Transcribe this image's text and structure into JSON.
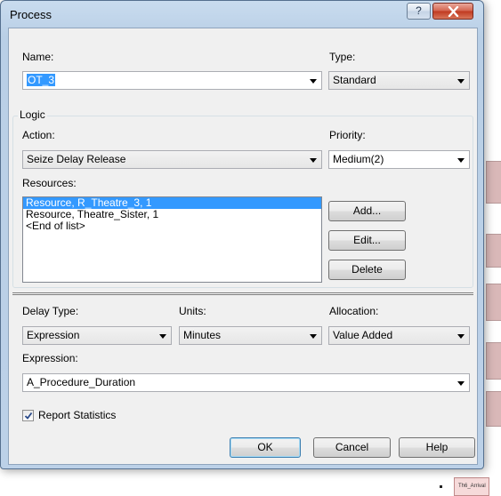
{
  "window": {
    "title": "Process",
    "help_glyph": "?",
    "close_glyph": "x"
  },
  "name": {
    "label": "Name:",
    "value": "OT_3"
  },
  "type": {
    "label": "Type:",
    "value": "Standard"
  },
  "logic": {
    "legend": "Logic",
    "action": {
      "label": "Action:",
      "value": "Seize Delay Release"
    },
    "priority": {
      "label": "Priority:",
      "value": "Medium(2)"
    },
    "resources": {
      "label": "Resources:",
      "items": [
        "Resource, R_Theatre_3, 1",
        "Resource, Theatre_Sister, 1",
        "<End of list>"
      ],
      "selected_index": 0
    },
    "buttons": {
      "add": "Add...",
      "edit": "Edit...",
      "delete": "Delete"
    }
  },
  "delay": {
    "delay_type": {
      "label": "Delay Type:",
      "value": "Expression"
    },
    "units": {
      "label": "Units:",
      "value": "Minutes"
    },
    "allocation": {
      "label": "Allocation:",
      "value": "Value Added"
    },
    "expression": {
      "label": "Expression:",
      "value": "A_Procedure_Duration"
    }
  },
  "report_statistics": {
    "label": "Report Statistics",
    "checked": true
  },
  "footer": {
    "ok": "OK",
    "cancel": "Cancel",
    "help": "Help"
  },
  "background": {
    "bottom_item": "Th6_Arrival"
  },
  "colors": {
    "selection": "#3399ff",
    "title_bar": "#bcd1e8",
    "close_button": "#c0381f"
  }
}
